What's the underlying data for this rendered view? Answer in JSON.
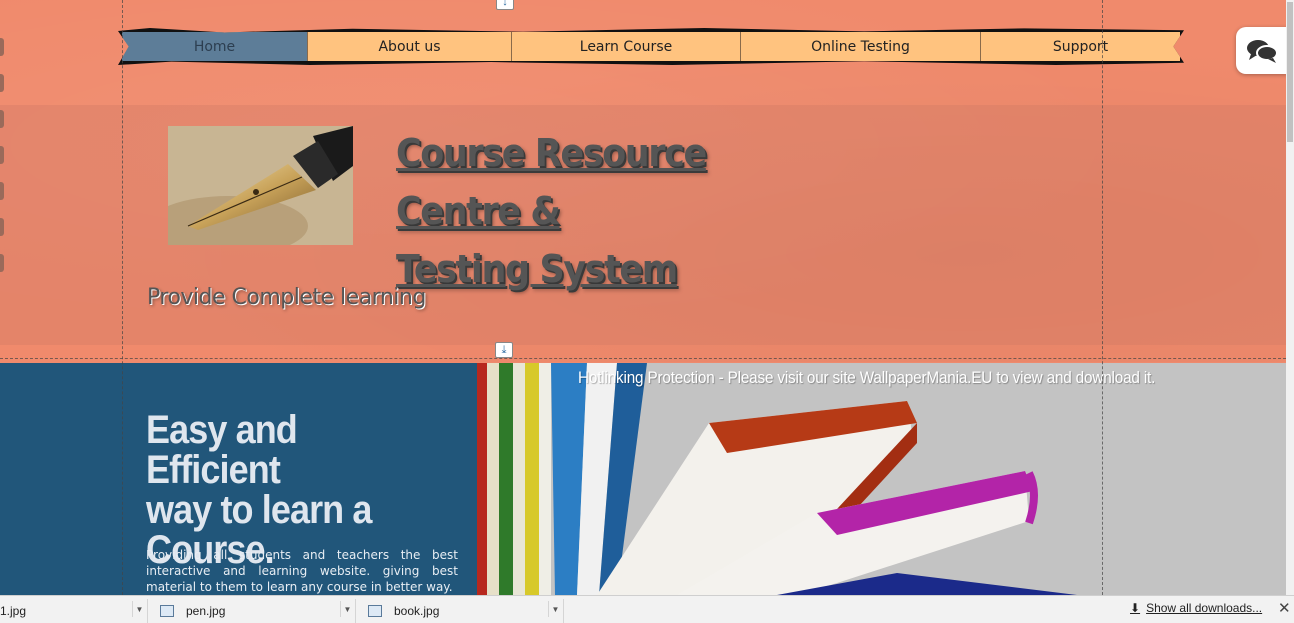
{
  "nav": {
    "items": [
      {
        "label": "Home",
        "active": true
      },
      {
        "label": "About us"
      },
      {
        "label": "Learn Course"
      },
      {
        "label": "Online Testing"
      },
      {
        "label": "Support"
      }
    ]
  },
  "header": {
    "title_line1": "Course Resource Centre &",
    "title_line2": "Testing System",
    "tagline": "Provide Complete learning",
    "logo_icon": "fountain-pen-image"
  },
  "hero": {
    "heading_line1": "Easy and Efficient",
    "heading_line2": "way to learn a",
    "heading_line3": "Course.",
    "text": "Providing all students and teachers the best interactive and learning website. giving best material to them to learn any course in better way.",
    "image_watermark": "Hotlinking Protection - Please visit our site WallpaperMania.EU to view and download it."
  },
  "chat_widget": {
    "icon": "chat-bubbles-icon"
  },
  "downloads": {
    "items": [
      {
        "name": "1.jpg"
      },
      {
        "name": "pen.jpg"
      },
      {
        "name": "book.jpg"
      }
    ],
    "show_all": "Show all downloads...",
    "close": "✕"
  },
  "colors": {
    "salmon_bg": "#f08a6c",
    "nav_bg": "#ffc37f",
    "nav_active": "#5d7d98",
    "hero_blue": "#21567a"
  }
}
